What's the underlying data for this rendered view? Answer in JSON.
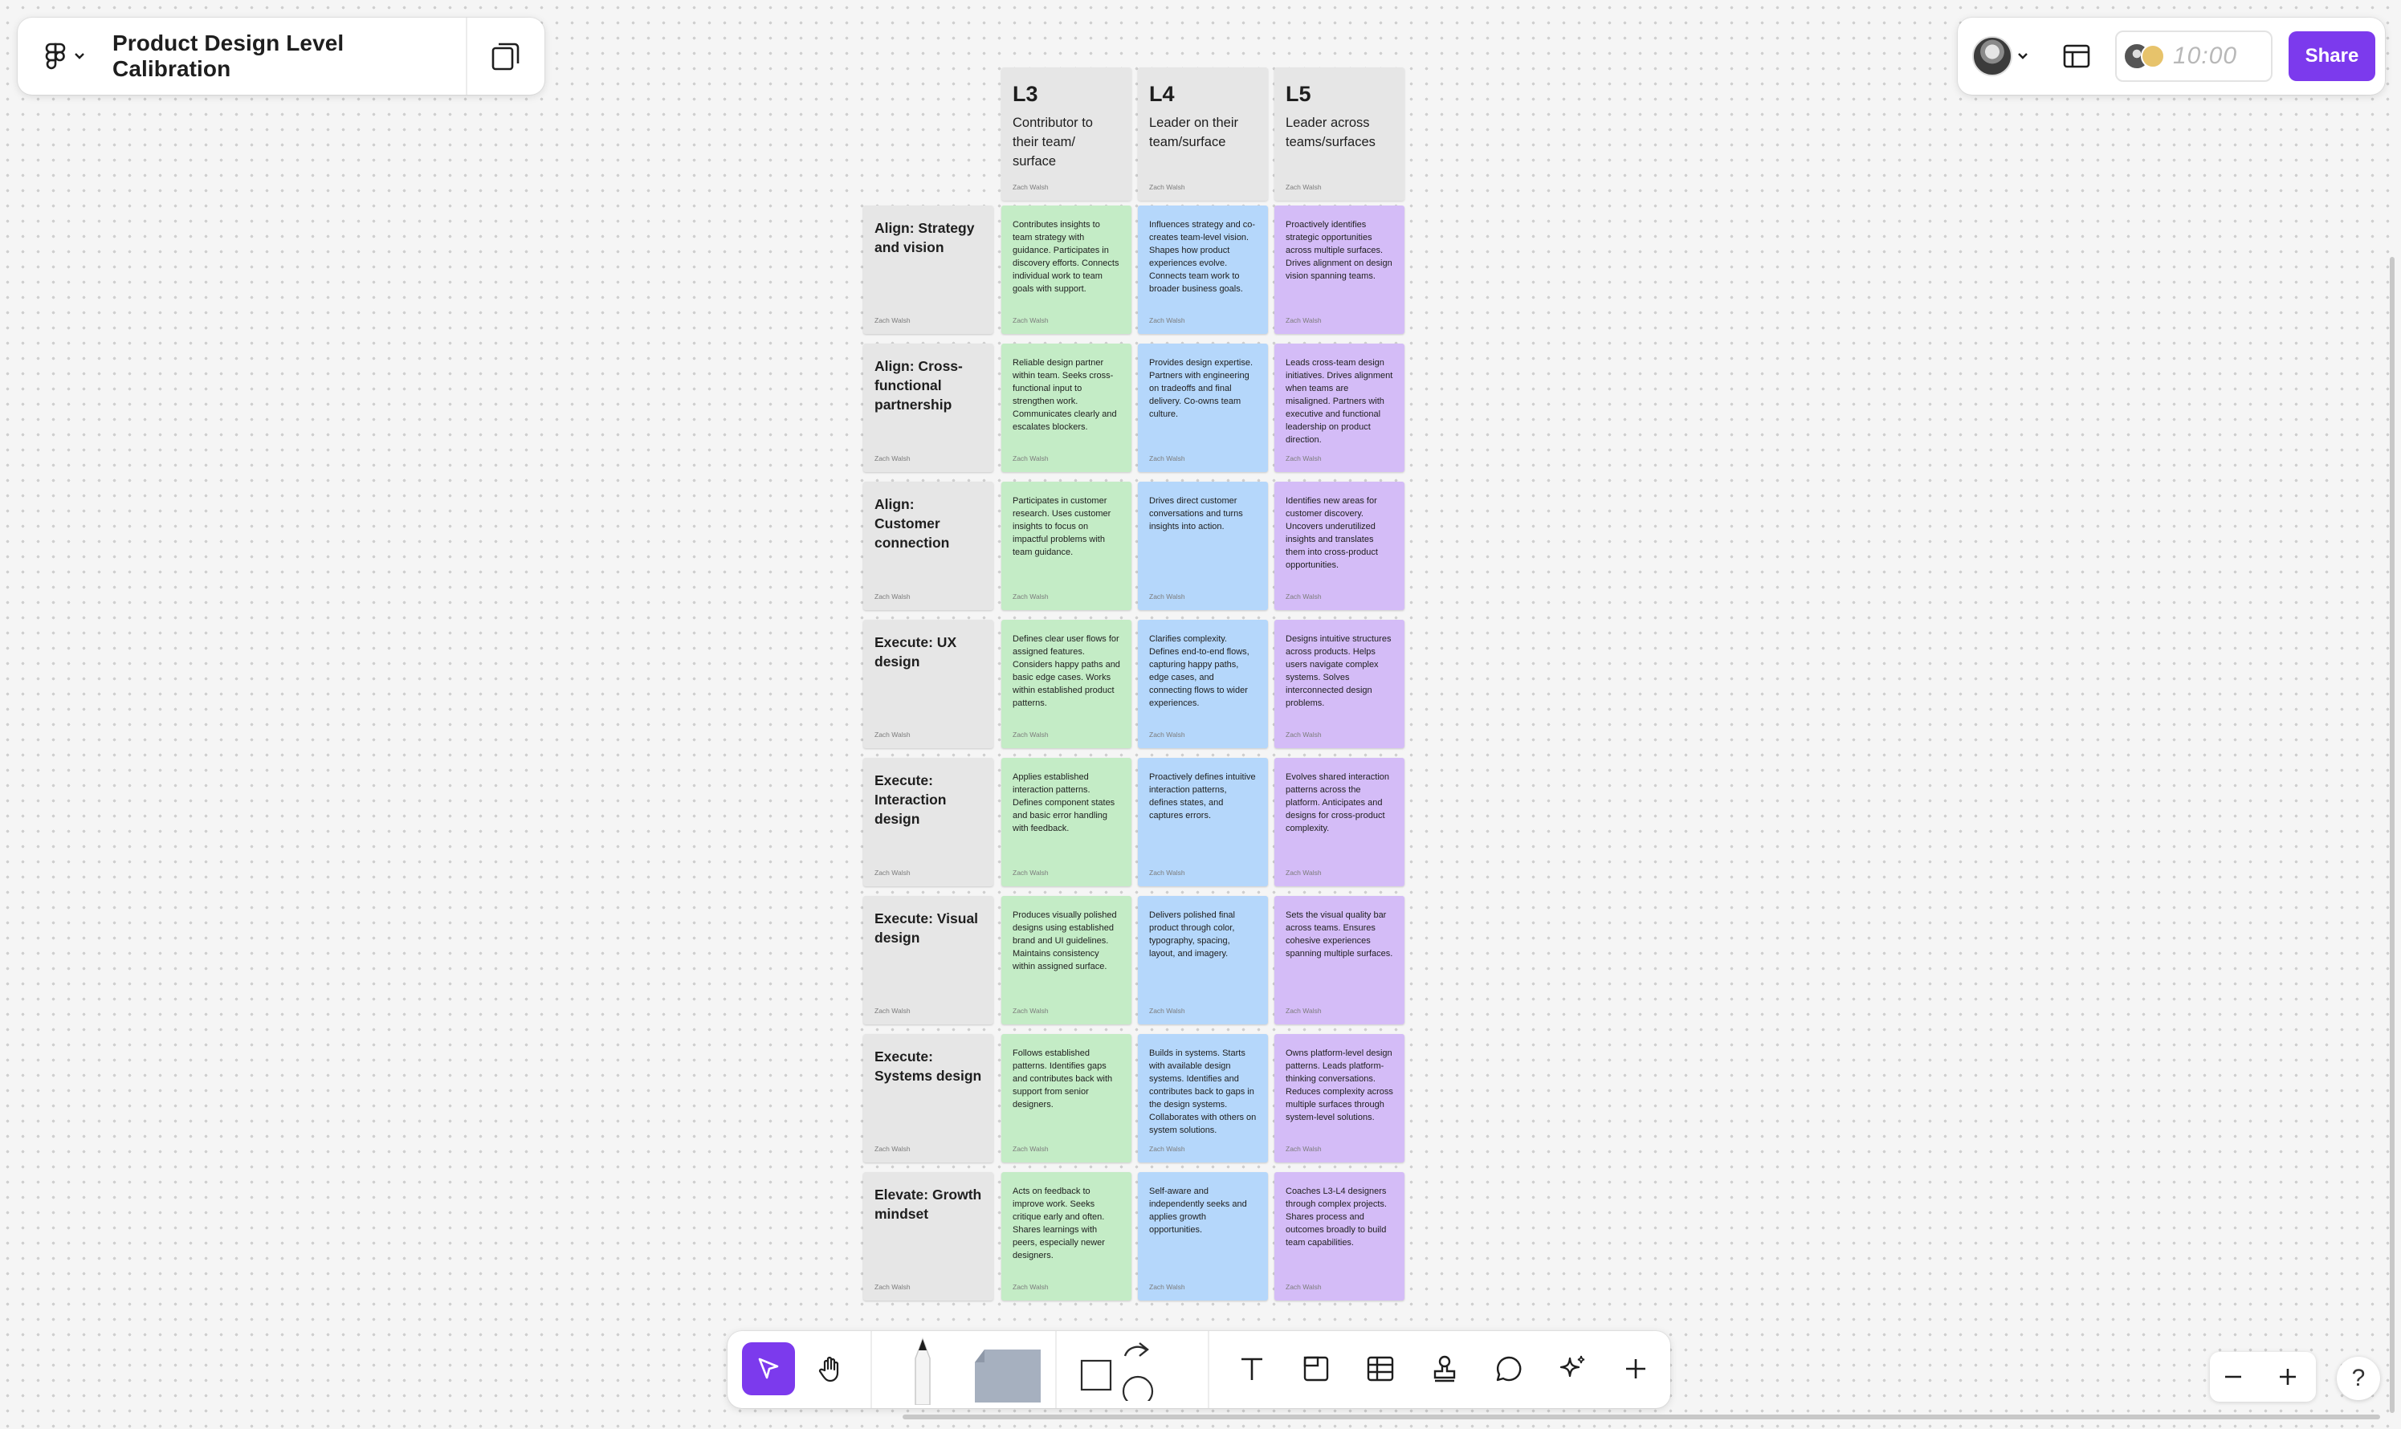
{
  "file": {
    "title": "Product Design Level Calibration"
  },
  "topbar": {
    "timer": "10:00",
    "share_label": "Share"
  },
  "board": {
    "author": "Zach Walsh",
    "columns": [
      {
        "level": "L3",
        "desc": "Contributor to their team/ surface",
        "color": "#c4ecc6"
      },
      {
        "level": "L4",
        "desc": "Leader on their team/surface",
        "color": "#b5d7fb"
      },
      {
        "level": "L5",
        "desc": "Leader across teams/surfaces",
        "color": "#d4bcf7"
      }
    ],
    "rows": [
      {
        "label": "Align: Strategy and vision",
        "cells": [
          "Contributes insights to team strategy with guidance. Participates in discovery efforts. Connects individual work to team goals with support.",
          "Influences strategy and co-creates team-level vision. Shapes how product experiences evolve. Connects team work to broader business goals.",
          "Proactively identifies strategic opportunities across multiple surfaces. Drives alignment on design vision spanning teams."
        ]
      },
      {
        "label": "Align: Cross-functional partnership",
        "cells": [
          "Reliable design partner within team. Seeks cross-functional input to strengthen work. Communicates clearly and escalates blockers.",
          "Provides design expertise. Partners with engineering on tradeoffs and final delivery. Co-owns team culture.",
          "Leads cross-team design initiatives. Drives alignment when teams are misaligned. Partners with executive and functional leadership on product direction."
        ]
      },
      {
        "label": "Align: Customer connection",
        "cells": [
          "Participates in customer research. Uses customer insights to focus on impactful problems with team guidance.",
          "Drives direct customer conversations and turns insights into action.",
          "Identifies new areas for customer discovery. Uncovers underutilized insights and translates them into cross-product opportunities."
        ]
      },
      {
        "label": "Execute: UX design",
        "cells": [
          "Defines clear user flows for assigned features. Considers happy paths and basic edge cases. Works within established product patterns.",
          "Clarifies complexity. Defines end-to-end flows, capturing happy paths, edge cases, and connecting flows to wider experiences.",
          "Designs intuitive structures across products. Helps users navigate complex systems. Solves interconnected design problems."
        ]
      },
      {
        "label": "Execute: Interaction design",
        "cells": [
          "Applies established interaction patterns. Defines component states and basic error handling with feedback.",
          "Proactively defines intuitive interaction patterns, defines states, and captures errors.",
          "Evolves shared interaction patterns across the platform. Anticipates and designs for cross-product complexity."
        ]
      },
      {
        "label": "Execute: Visual design",
        "cells": [
          "Produces visually polished designs using established brand and UI guidelines. Maintains consistency within assigned surface.",
          "Delivers polished final product through color, typography, spacing, layout, and imagery.",
          "Sets the visual quality bar across teams. Ensures cohesive experiences spanning multiple surfaces."
        ]
      },
      {
        "label": "Execute: Systems design",
        "cells": [
          "Follows established patterns. Identifies gaps and contributes back with support from senior designers.",
          "Builds in systems. Starts with available design systems. Identifies and contributes back to gaps in the design systems. Collaborates with others on system solutions.",
          "Owns platform-level design patterns. Leads platform-thinking conversations. Reduces complexity across multiple surfaces through system-level solutions."
        ]
      },
      {
        "label": "Elevate: Growth mindset",
        "cells": [
          "Acts on feedback to improve work. Seeks critique early and often. Shares learnings with peers, especially newer designers.",
          "Self-aware and independently seeks and applies growth opportunities.",
          "Coaches L3-L4 designers through complex projects. Shares process and outcomes broadly to build team capabilities."
        ]
      }
    ]
  },
  "toolbar": {
    "tools": [
      "move-icon",
      "hand-icon",
      "pen-icon",
      "marker-icon",
      "shape-icon",
      "connector-icon",
      "text-icon",
      "section-icon",
      "table-icon",
      "stamp-icon",
      "comment-icon",
      "ai-sparkle-icon",
      "plus-icon"
    ],
    "active_tool": "move-icon",
    "accent": "#7c3aed"
  },
  "zoom": {
    "help_label": "?"
  }
}
